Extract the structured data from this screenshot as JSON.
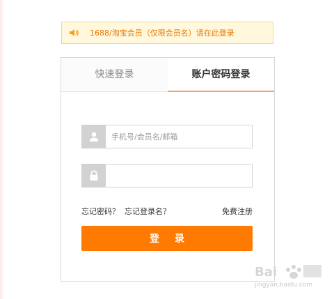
{
  "notice": {
    "text": "1688/淘宝会员（仅限会员名）请在此登录",
    "icon": "speaker-icon"
  },
  "tabs": [
    {
      "label": "快速登录",
      "active": false
    },
    {
      "label": "账户密码登录",
      "active": true
    }
  ],
  "form": {
    "username": {
      "value": "",
      "placeholder": "手机号/会员名/邮箱",
      "icon": "user-icon"
    },
    "password": {
      "value": "",
      "placeholder": "",
      "icon": "lock-icon"
    }
  },
  "links": {
    "forgot_password": "忘记密码？",
    "forgot_username": "忘记登录名？",
    "register": "免费注册"
  },
  "login_button": {
    "label": "登录"
  },
  "watermark": {
    "text": "jingyan.baidu.com"
  },
  "colors": {
    "accent": "#ff7a00",
    "notice_text": "#e8780a",
    "notice_bg": "#fff8dc",
    "tab_underline": "#f3a06a"
  }
}
